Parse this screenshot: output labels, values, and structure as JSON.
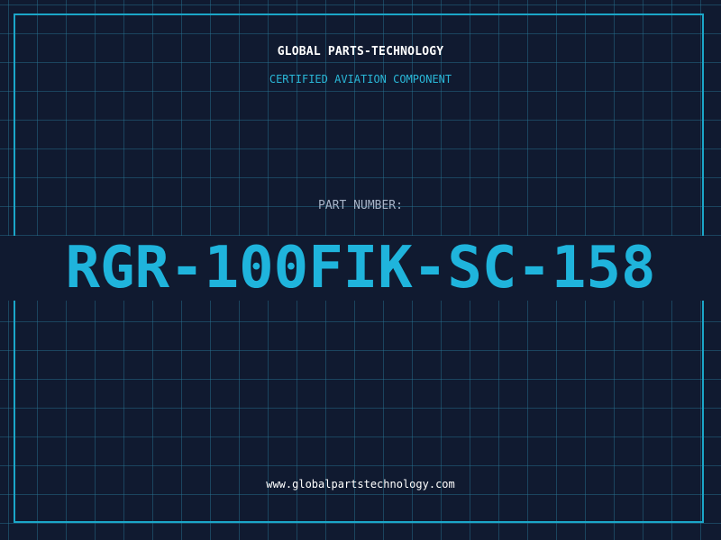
{
  "header": {
    "company": "GLOBAL PARTS-TECHNOLOGY",
    "subtitle": "CERTIFIED AVIATION COMPONENT"
  },
  "part": {
    "label": "PART NUMBER:",
    "number": "RGR-100FIK-SC-158"
  },
  "footer": {
    "url": "www.globalpartstechnology.com"
  },
  "colors": {
    "background": "#101a30",
    "accent": "#1fb4dc",
    "grid": "#287896"
  }
}
